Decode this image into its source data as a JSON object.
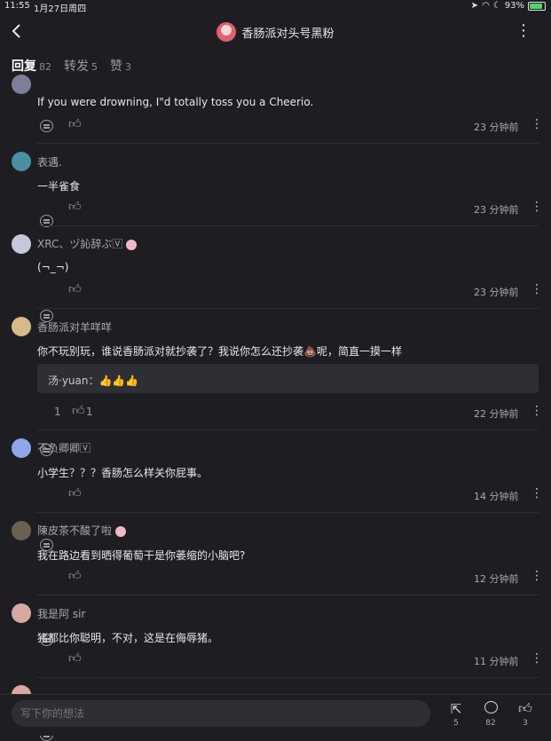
{
  "status_bar": {
    "time": "11:55",
    "date": "1月27日周四",
    "battery": "93%"
  },
  "header": {
    "title": "香肠派对头号黑粉"
  },
  "tabs": [
    {
      "label": "回复",
      "count": "82"
    },
    {
      "label": "转发",
      "count": "5"
    },
    {
      "label": "赞",
      "count": "3"
    }
  ],
  "comments": [
    {
      "user": "",
      "text": "If you were drowning, I\"d totally toss you a Cheerio.",
      "time": "23 分钟前",
      "reply_count": "",
      "like_count": ""
    },
    {
      "user": "表遇.",
      "text": "一半雀食",
      "time": "23 分钟前",
      "reply_count": "",
      "like_count": ""
    },
    {
      "user": "XRC、ヅ訫辞ぶ🅅",
      "text": "(¬_¬)",
      "time": "23 分钟前",
      "reply_count": "",
      "like_count": ""
    },
    {
      "user": "香肠派对羊咩咩",
      "text": "你不玩别玩，谁说香肠派对就抄袭了？我说你怎么还抄袭💩呢，简直一摸一样",
      "time": "22 分钟前",
      "reply_count": "1",
      "like_count": "1",
      "reply": {
        "text": "汤·yuan：👍👍👍"
      }
    },
    {
      "user": "不负卿卿🅅",
      "text": "小学生？？？香肠怎么样关你屁事。",
      "time": "14 分钟前",
      "reply_count": "",
      "like_count": ""
    },
    {
      "user": "陳皮茶不酸了啦",
      "text": "我在路边看到晒得葡萄干是你萎缩的小脑吧?",
      "time": "12 分钟前",
      "reply_count": "",
      "like_count": ""
    },
    {
      "user": "我是阿 sir",
      "text": "猪都比你聪明，不对，这是在侮辱猪。",
      "time": "11 分钟前",
      "reply_count": "",
      "like_count": ""
    }
  ],
  "bottom_bar": {
    "placeholder": "写下你的想法",
    "share_count": "5",
    "comment_count": "82",
    "like_count": "3"
  }
}
